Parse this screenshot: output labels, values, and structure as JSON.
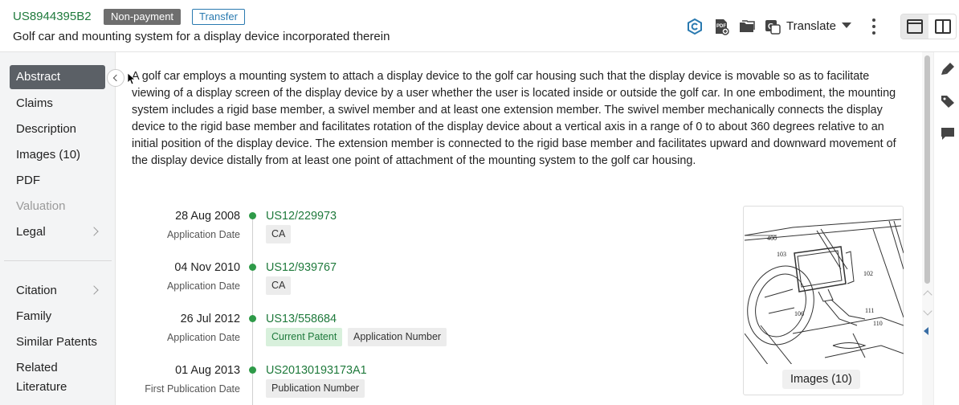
{
  "header": {
    "patent_number": "US8944395B2",
    "badge_status": "Non-payment",
    "badge_transfer": "Transfer",
    "title": "Golf car and mounting system for a display device incorporated therein",
    "translate_label": "Translate",
    "icons": [
      "patsnap-logo-icon",
      "pdf-download-icon",
      "folder-icon",
      "translate-icon",
      "chevron-down-icon",
      "more-vertical-icon",
      "single-view-icon",
      "split-view-icon"
    ]
  },
  "sidebar": {
    "items": [
      {
        "label": "Abstract",
        "active": true
      },
      {
        "label": "Claims"
      },
      {
        "label": "Description"
      },
      {
        "label": "Images (10)"
      },
      {
        "label": "PDF"
      },
      {
        "label": "Valuation",
        "disabled": true
      },
      {
        "label": "Legal",
        "chevron": true
      }
    ],
    "items2": [
      {
        "label": "Citation",
        "chevron": true
      },
      {
        "label": "Family"
      },
      {
        "label": "Similar Patents"
      },
      {
        "label": "Related"
      },
      {
        "label": "Literature"
      }
    ]
  },
  "abstract": {
    "text": "A golf car employs a mounting system to attach a display device to the golf car housing such that the display device is movable so as to facilitate viewing of a display screen of the display device by a user whether the user is located inside or outside the golf car. In one embodiment, the mounting system includes a rigid base member, a swivel member and at least one extension member. The swivel member mechanically connects the display device to the rigid base member and facilitates rotation of the display device about a vertical axis in a range of 0 to about 360 degrees relative to an initial position of the display device. The extension member is connected to the rigid base member and facilitates upward and downward movement of the display device distally from at least one point of attachment of the mounting system to the golf car housing."
  },
  "timeline": [
    {
      "date": "28 Aug 2008",
      "type": "Application Date",
      "number": "US12/229973",
      "tags": [
        "CA"
      ]
    },
    {
      "date": "04 Nov 2010",
      "type": "Application Date",
      "number": "US12/939767",
      "tags": [
        "CA"
      ]
    },
    {
      "date": "26 Jul 2012",
      "type": "Application Date",
      "number": "US13/558684",
      "tags": [
        "Current Patent",
        "Application Number"
      ]
    },
    {
      "date": "01 Aug 2013",
      "type": "First Publication Date",
      "number": "US20130193173A1",
      "tags": [
        "Publication Number"
      ]
    }
  ],
  "image_card": {
    "button_label": "Images (10)",
    "figure_labels": [
      "400",
      "103",
      "102",
      "106",
      "111",
      "110"
    ]
  },
  "colors": {
    "accent_green": "#1f7a3c",
    "active_nav": "#5b6066",
    "badge_gray": "#6e6e6e",
    "badge_blue": "#2a7ab0",
    "dot_green": "#2e9a48"
  },
  "right_rail_icons": [
    "highlighter-icon",
    "tag-icon",
    "comment-icon"
  ]
}
